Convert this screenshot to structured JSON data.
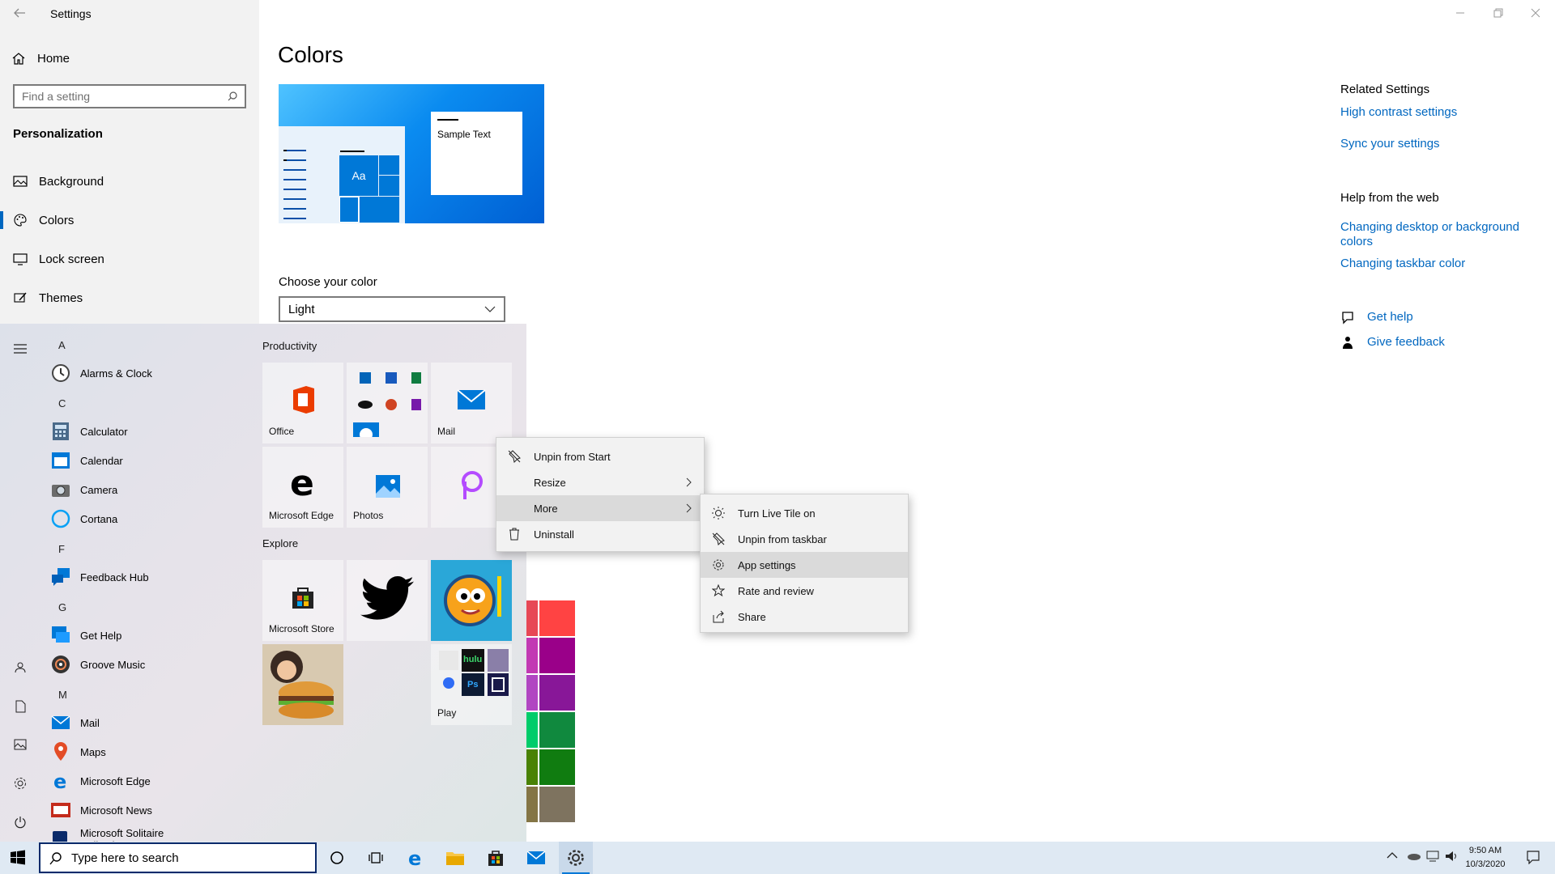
{
  "window": {
    "title": "Settings",
    "controls": [
      "minimize-icon",
      "restore-icon",
      "close-icon"
    ]
  },
  "sidebar": {
    "home_label": "Home",
    "search_placeholder": "Find a setting",
    "section_title": "Personalization",
    "items": [
      {
        "label": "Background",
        "icon": "picture-icon"
      },
      {
        "label": "Colors",
        "icon": "palette-icon",
        "selected": true
      },
      {
        "label": "Lock screen",
        "icon": "monitor-icon"
      },
      {
        "label": "Themes",
        "icon": "brush-icon"
      }
    ]
  },
  "main": {
    "title": "Colors",
    "preview_sample_text": "Sample Text",
    "preview_tile_text": "Aa",
    "choose_label": "Choose your color",
    "choose_value": "Light"
  },
  "related": {
    "heading": "Related Settings",
    "links": [
      "High contrast settings",
      "Sync your settings"
    ],
    "web_heading": "Help from the web",
    "web_links": [
      "Changing desktop or background colors",
      "Changing taskbar color"
    ],
    "get_help": "Get help",
    "feedback": "Give feedback"
  },
  "start": {
    "letters": [
      "A",
      "C",
      "F",
      "G",
      "M"
    ],
    "apps": [
      {
        "label": "Alarms & Clock",
        "icon": "alarm-clock-icon"
      },
      {
        "label": "Calculator",
        "icon": "calculator-icon"
      },
      {
        "label": "Calendar",
        "icon": "calendar-icon"
      },
      {
        "label": "Camera",
        "icon": "camera-icon"
      },
      {
        "label": "Cortana",
        "icon": "cortana-icon"
      },
      {
        "label": "Feedback Hub",
        "icon": "feedback-hub-icon"
      },
      {
        "label": "Get Help",
        "icon": "get-help-icon"
      },
      {
        "label": "Groove Music",
        "icon": "groove-music-icon"
      },
      {
        "label": "Mail",
        "icon": "mail-icon"
      },
      {
        "label": "Maps",
        "icon": "maps-icon"
      },
      {
        "label": "Microsoft Edge",
        "icon": "edge-icon"
      },
      {
        "label": "Microsoft News",
        "icon": "news-icon"
      },
      {
        "label": "Microsoft Solitaire Collection",
        "icon": "solitaire-icon"
      }
    ],
    "groups": {
      "productivity": "Productivity",
      "explore": "Explore"
    },
    "tiles": {
      "office": "Office",
      "mail": "Mail",
      "edge": "Microsoft Edge",
      "photos": "Photos",
      "store": "Microsoft Store",
      "play": "Play",
      "hulu": "hulu",
      "ps": "Ps"
    }
  },
  "context_menu": {
    "items": [
      "Unpin from Start",
      "Resize",
      "More",
      "Uninstall"
    ],
    "submenu": [
      "Turn Live Tile on",
      "Unpin from taskbar",
      "App settings",
      "Rate and review",
      "Share"
    ],
    "highlighted": "App settings"
  },
  "swatch_colors": [
    "#e74856",
    "#ff4343",
    "#c239b3",
    "#9a0089",
    "#b146c2",
    "#881798",
    "#00cc6a",
    "#10893e",
    "#498205",
    "#107c10",
    "#847545",
    "#7e735f"
  ],
  "taskbar": {
    "search_placeholder": "Type here to search",
    "time": "9:50 AM",
    "date": "10/3/2020"
  }
}
